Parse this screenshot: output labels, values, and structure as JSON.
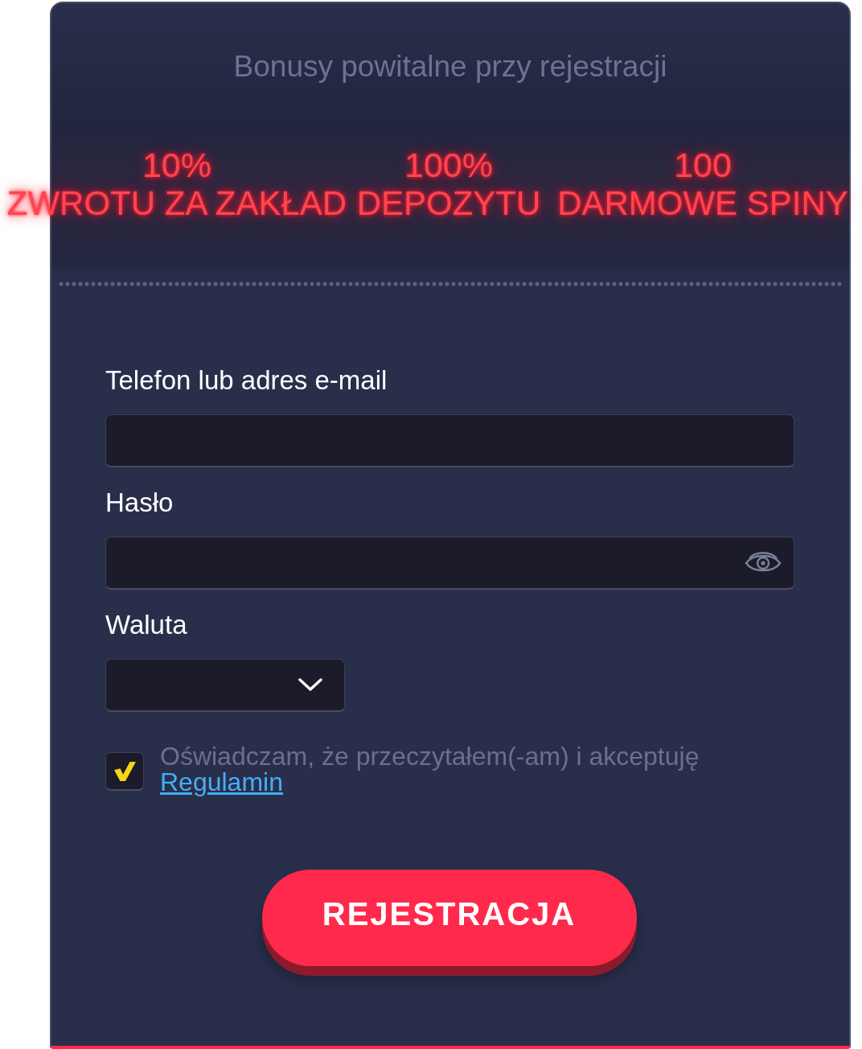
{
  "header": {
    "title": "Bonusy powitalne przy rejestracji"
  },
  "bonuses": [
    {
      "value": "10%",
      "label": "ZWROTU ZA ZAKŁAD"
    },
    {
      "value": "100%",
      "label": "DEPOZYTU"
    },
    {
      "value": "100",
      "label": "DARMOWE SPINY"
    }
  ],
  "form": {
    "fields": [
      {
        "kind": "text",
        "label": "Telefon lub adres e-mail"
      },
      {
        "kind": "password",
        "label": "Hasło"
      },
      {
        "kind": "select",
        "label": "Waluta"
      }
    ],
    "consent": {
      "checked": true,
      "text": "Oświadczam, że przeczytałem(-am) i akceptuję",
      "link": "Regulamin"
    },
    "submit": "REJESTRACJA"
  }
}
